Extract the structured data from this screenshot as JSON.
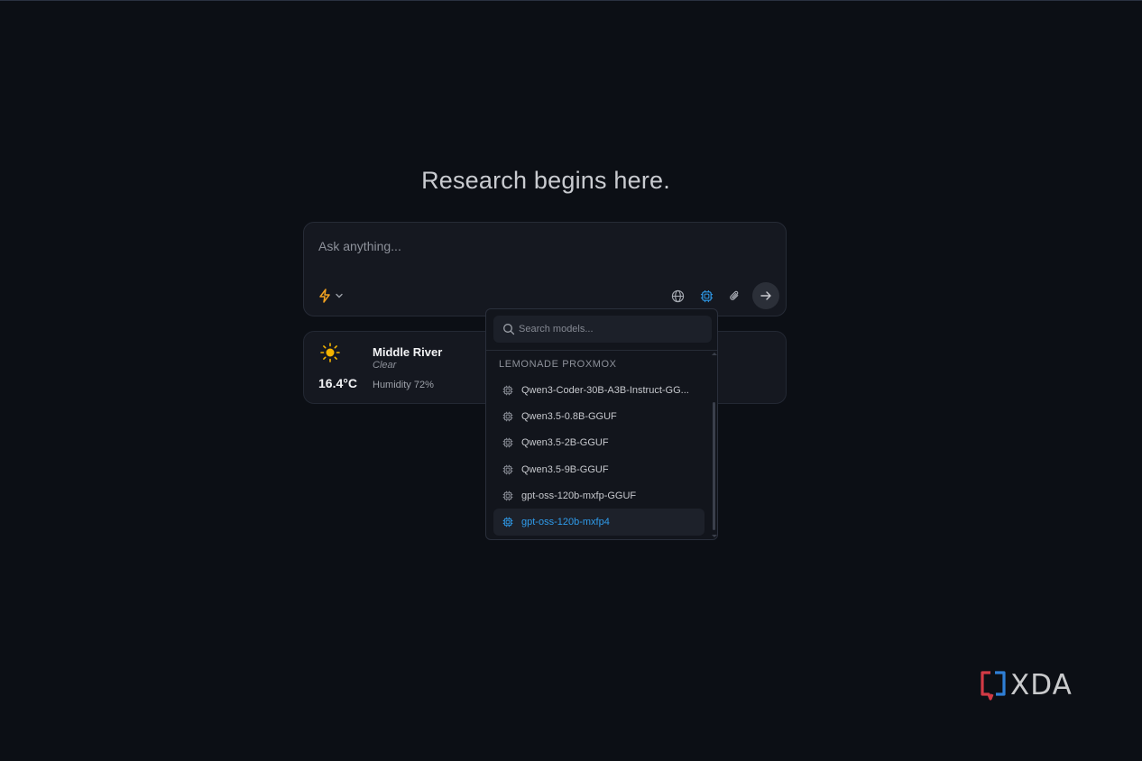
{
  "headline": "Research begins here.",
  "composer": {
    "placeholder": "Ask anything...",
    "mode_icon": "lightning-icon",
    "mode_chevron": "chevron-down-icon",
    "tools": [
      "globe-icon",
      "chip-icon",
      "paperclip-icon"
    ],
    "send_icon": "arrow-right-icon"
  },
  "weather": {
    "icon": "sun-icon",
    "temperature": "16.4°C",
    "city": "Middle River",
    "condition": "Clear",
    "humidity": "Humidity 72%"
  },
  "model_picker": {
    "search_placeholder": "Search models...",
    "group_label": "LEMONADE PROXMOX",
    "models": [
      {
        "name": "Qwen3-Coder-30B-A3B-Instruct-GG...",
        "selected": false
      },
      {
        "name": "Qwen3.5-0.8B-GGUF",
        "selected": false
      },
      {
        "name": "Qwen3.5-2B-GGUF",
        "selected": false
      },
      {
        "name": "Qwen3.5-9B-GGUF",
        "selected": false
      },
      {
        "name": "gpt-oss-120b-mxfp-GGUF",
        "selected": false
      },
      {
        "name": "gpt-oss-120b-mxfp4",
        "selected": true
      }
    ]
  },
  "watermark": {
    "text": "XDA"
  },
  "colors": {
    "background": "#0c0f15",
    "accent_blue": "#2f9bea",
    "accent_orange": "#f0a020",
    "sun_yellow": "#f5b400"
  }
}
